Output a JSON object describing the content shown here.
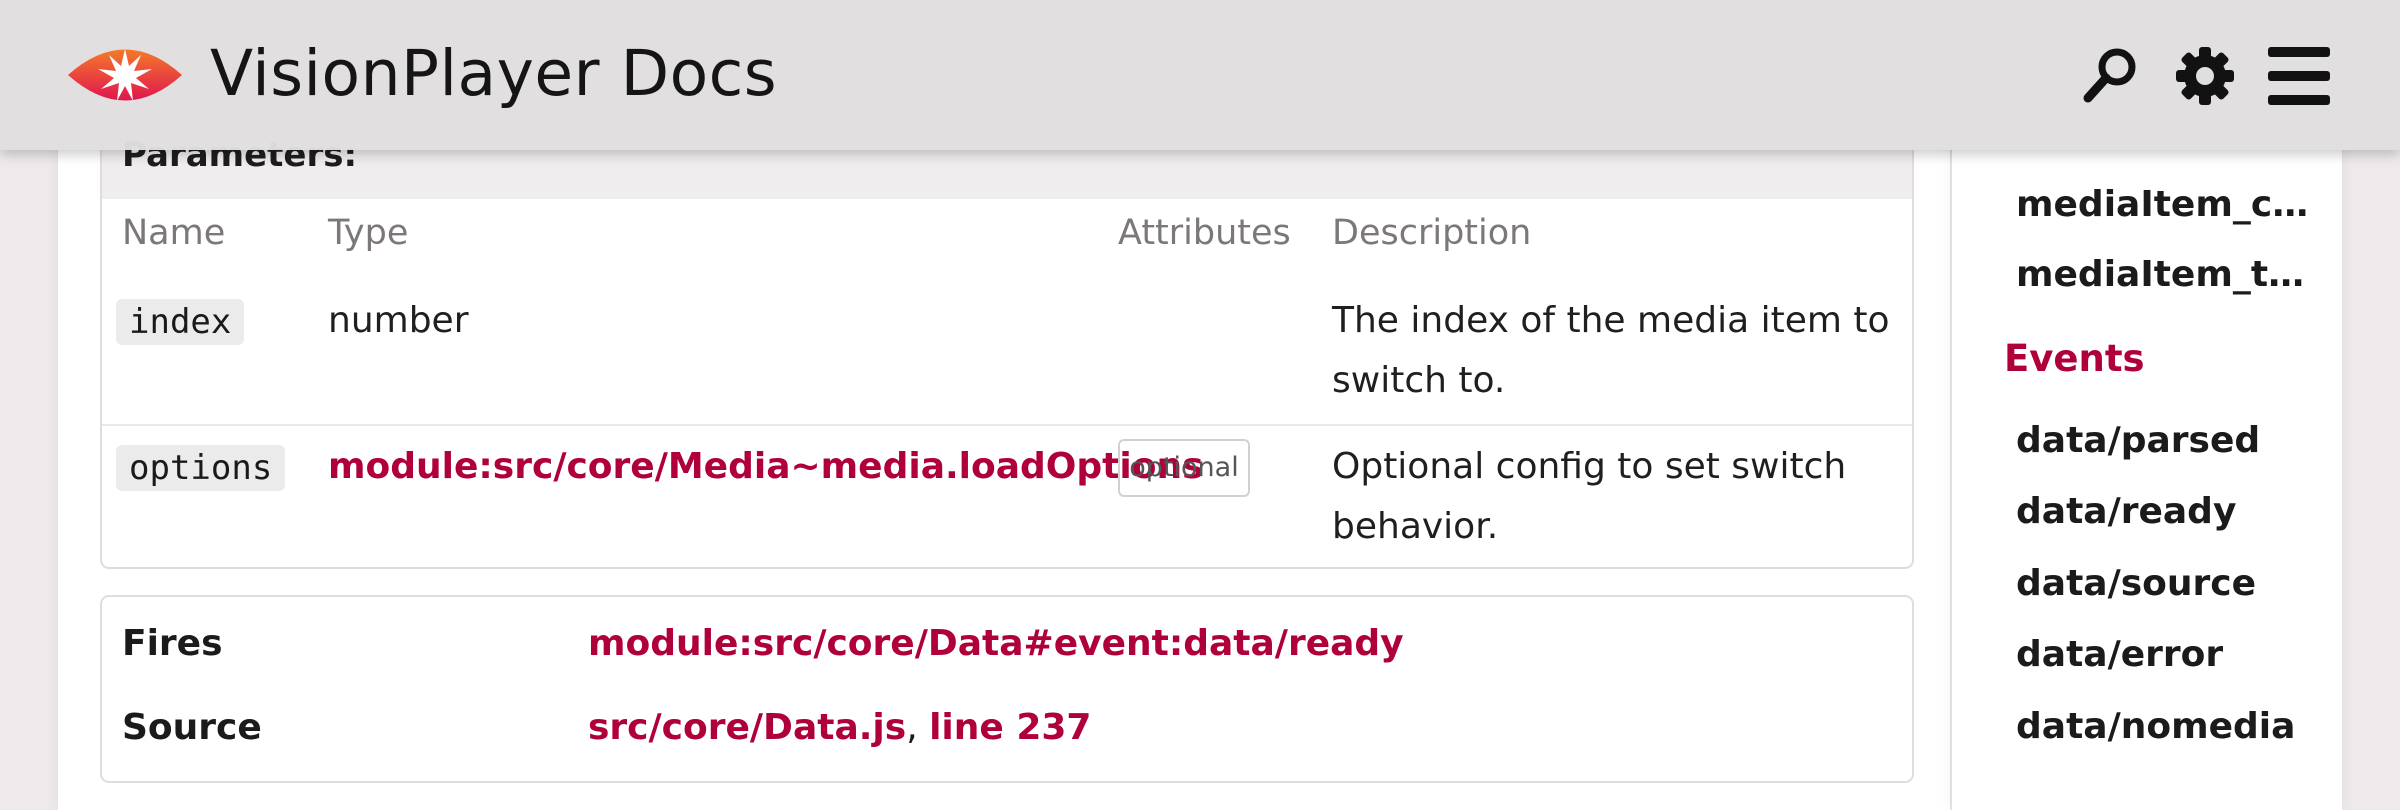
{
  "header": {
    "title": "VisionPlayer Docs",
    "icons": [
      "logo-icon",
      "search-icon",
      "gear-icon",
      "hamburger-icon"
    ]
  },
  "params": {
    "heading": "Parameters:",
    "columns": [
      "Name",
      "Type",
      "Attributes",
      "Description"
    ],
    "rows": [
      {
        "name": "index",
        "type": "number",
        "attribute": "",
        "description_1": "The index of the media item to",
        "description_2": "switch to."
      },
      {
        "name": "options",
        "type": "module:src/core/Media~media.loadOptions",
        "attribute": "optional",
        "description_1": "Optional config to set switch",
        "description_2": "behavior."
      }
    ]
  },
  "meta": {
    "fires_label": "Fires",
    "fires_value": "module:src/core/Data#event:data/ready",
    "source_label": "Source",
    "source_file": "src/core/Data.js",
    "source_sep": ", ",
    "source_line": "line 237"
  },
  "sidebar": {
    "members": [
      "mediaItem_c…",
      "mediaItem_t…"
    ],
    "events_heading": "Events",
    "events": [
      "data/parsed",
      "data/ready",
      "data/source",
      "data/error",
      "data/nomedia"
    ]
  },
  "colors": {
    "accent": "#b0003a",
    "logo_gradient_top": "#f47a2a",
    "logo_gradient_bottom": "#e0154f"
  }
}
